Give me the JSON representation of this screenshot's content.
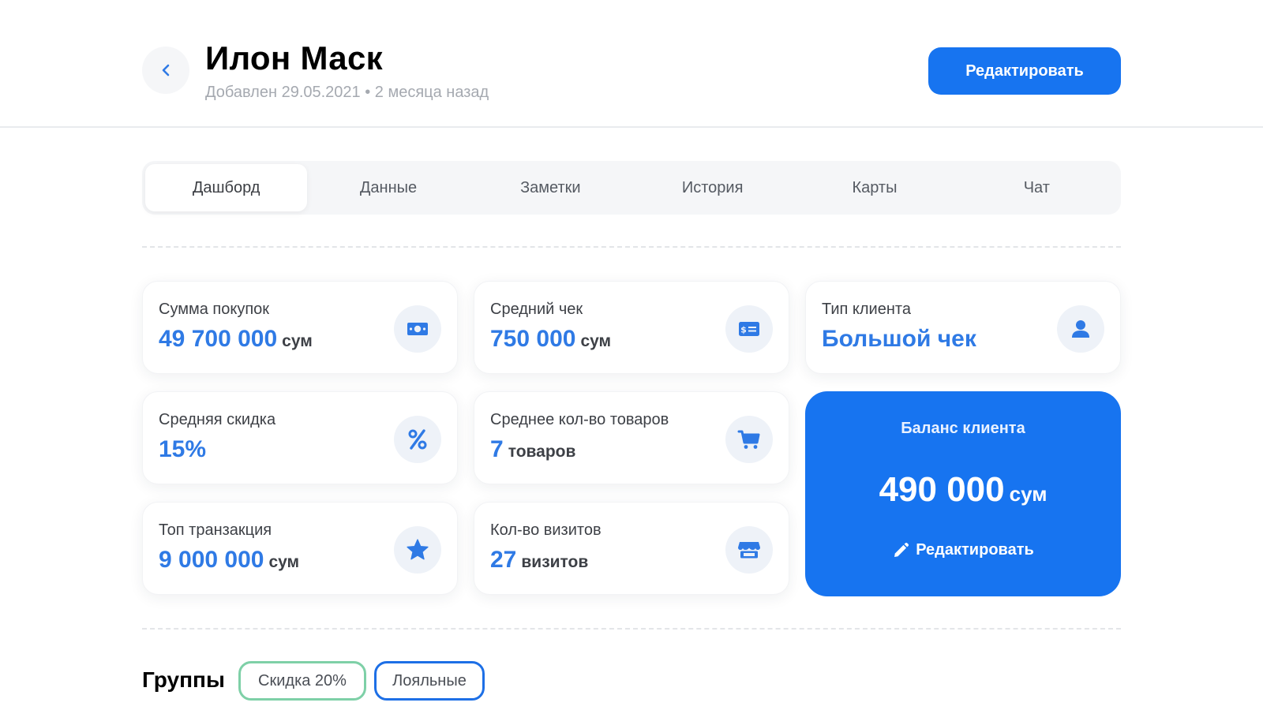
{
  "header": {
    "title": "Илон Маск",
    "subtitle": "Добавлен 29.05.2021 • 2 месяца назад",
    "edit_label": "Редактировать"
  },
  "tabs": [
    {
      "label": "Дашборд",
      "active": true
    },
    {
      "label": "Данные"
    },
    {
      "label": "Заметки"
    },
    {
      "label": "История"
    },
    {
      "label": "Карты"
    },
    {
      "label": "Чат"
    }
  ],
  "stats": {
    "purchases": {
      "label": "Сумма покупок",
      "value": "49 700 000",
      "unit": "сум",
      "icon": "money-icon"
    },
    "avg_check": {
      "label": "Средний чек",
      "value": "750 000",
      "unit": "сум",
      "icon": "receipt-icon"
    },
    "client_type": {
      "label": "Тип клиента",
      "value": "Большой чек",
      "unit": "",
      "icon": "user-icon"
    },
    "avg_discount": {
      "label": "Средняя скидка",
      "value": "15%",
      "unit": "",
      "icon": "percent-icon"
    },
    "avg_items": {
      "label": "Среднее кол-во товаров",
      "value": "7",
      "unit": "товаров",
      "icon": "cart-icon"
    },
    "top_transaction": {
      "label": "Топ транзакция",
      "value": "9 000 000",
      "unit": "сум",
      "icon": "star-icon"
    },
    "visits": {
      "label": "Кол-во визитов",
      "value": "27",
      "unit": "визитов",
      "icon": "store-icon"
    }
  },
  "balance": {
    "label": "Баланс клиента",
    "value": "490 000",
    "unit": "сум",
    "edit_label": "Редактировать"
  },
  "groups": {
    "title": "Группы",
    "chips": [
      "Скидка 20%",
      "Лояльные"
    ]
  },
  "colors": {
    "accent": "#1774f0",
    "value_blue": "#2f7ae5",
    "chip_green": "#7ed0a7",
    "chip_blue": "#1d6fe6"
  }
}
